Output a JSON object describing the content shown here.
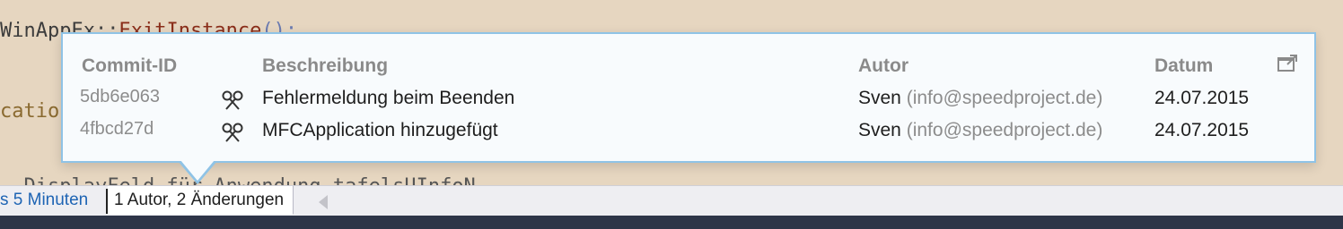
{
  "editor": {
    "line1_a": "WinAppEx",
    "line1_op": "::",
    "line1_fn": "ExitInstance",
    "line1_paren": "();",
    "line2": "catio",
    "line3": "  DisplayFeld für Anwendung.tafelsUInfoN"
  },
  "popup": {
    "columns": {
      "commit_id": "Commit-ID",
      "description": "Beschreibung",
      "author": "Autor",
      "date": "Datum"
    },
    "rows": [
      {
        "commit_id": "5db6e063",
        "icon": "commit-icon",
        "description": "Fehlermeldung beim Beenden",
        "author_name": "Sven",
        "author_email": "(info@speedproject.de)",
        "date": "24.07.2015"
      },
      {
        "commit_id": "4fbcd27d",
        "icon": "commit-icon",
        "description": "MFCApplication hinzugefügt",
        "author_name": "Sven",
        "author_email": "(info@speedproject.de)",
        "date": "24.07.2015"
      }
    ],
    "popout_icon": "popout-icon"
  },
  "status": {
    "time": "s 5 Minuten",
    "authors_changes": "1 Autor, 2 Änderungen"
  },
  "colors": {
    "editor_bg": "#e6d6c0",
    "popup_border": "#8fc3e6",
    "link_blue": "#1e64b4"
  }
}
